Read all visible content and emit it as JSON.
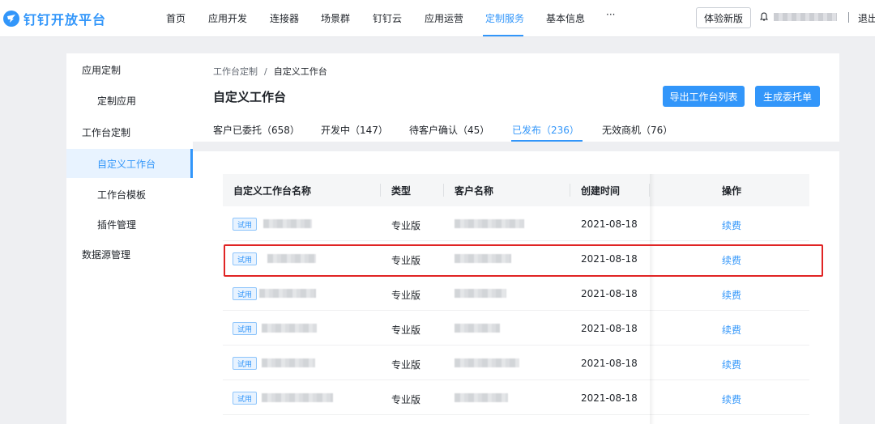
{
  "brand": {
    "name": "钉钉开放平台",
    "accent": "#3296fa"
  },
  "topnav": {
    "items": [
      "首页",
      "应用开发",
      "连接器",
      "场景群",
      "钉钉云",
      "应用运营",
      "定制服务",
      "基本信息",
      "···"
    ],
    "active": "定制服务",
    "trial_button": "体验新版",
    "bell_icon": "bell-icon",
    "logout": "退出"
  },
  "sidebar": {
    "groups": [
      {
        "label": "应用定制",
        "items": [
          "定制应用"
        ]
      },
      {
        "label": "工作台定制",
        "items": [
          "自定义工作台",
          "工作台模板",
          "插件管理"
        ]
      },
      {
        "label": "数据源管理",
        "items": []
      }
    ],
    "active": "自定义工作台"
  },
  "breadcrumb": [
    "工作台定制",
    "自定义工作台"
  ],
  "breadcrumb_separator": "/",
  "page": {
    "title": "自定义工作台",
    "buttons": {
      "export": "导出工作台列表",
      "create": "生成委托单"
    }
  },
  "tabs": [
    "客户已委托（658）",
    "开发中（147）",
    "待客户确认（45）",
    "已发布（236）",
    "无效商机（76）"
  ],
  "active_tab": "已发布（236）",
  "table": {
    "columns": [
      "自定义工作台名称",
      "类型",
      "客户名称",
      "创建时间",
      "操作"
    ],
    "rows": [
      {
        "tag": "试用",
        "type": "专业版",
        "created": "2021-08-18",
        "action": "续费"
      },
      {
        "tag": "试用",
        "type": "专业版",
        "created": "2021-08-18",
        "action": "续费"
      },
      {
        "tag": "试用",
        "type": "专业版",
        "created": "2021-08-18",
        "action": "续费"
      },
      {
        "tag": "试用",
        "type": "专业版",
        "created": "2021-08-18",
        "action": "续费"
      },
      {
        "tag": "试用",
        "type": "专业版",
        "created": "2021-08-18",
        "action": "续费"
      },
      {
        "tag": "试用",
        "type": "专业版",
        "created": "2021-08-18",
        "action": "续费"
      }
    ],
    "highlighted_row": 2
  },
  "highlight_color": "#e02424"
}
